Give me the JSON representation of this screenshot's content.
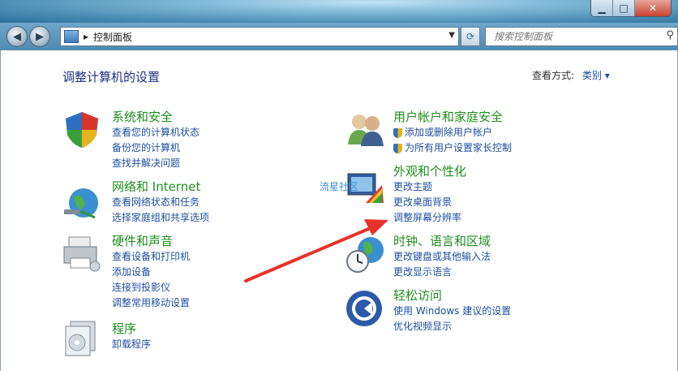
{
  "window": {
    "minimize_glyph": "▁",
    "maximize_glyph": "□",
    "close_glyph": "✕"
  },
  "nav": {
    "back_glyph": "◀",
    "forward_glyph": "▶",
    "address_crumb": "控制面板",
    "address_separator": "▸",
    "search_placeholder": "搜索控制面板"
  },
  "page": {
    "title": "调整计算机的设置",
    "view_by_label": "查看方式:",
    "view_by_value": "类别 ▾"
  },
  "categories": [
    {
      "title": "系统和安全",
      "links": [
        "查看您的计算机状态",
        "备份您的计算机",
        "查找并解决问题"
      ],
      "icon": "shield-icon"
    },
    {
      "title": "网络和 Internet",
      "links": [
        "查看网络状态和任务",
        "选择家庭组和共享选项"
      ],
      "icon": "network-globe-icon"
    },
    {
      "title": "硬件和声音",
      "links": [
        "查看设备和打印机",
        "添加设备",
        "连接到投影仪",
        "调整常用移动设置"
      ],
      "icon": "printer-icon"
    },
    {
      "title": "程序",
      "links": [
        "卸载程序"
      ],
      "icon": "programs-icon"
    },
    {
      "title": "用户帐户和家庭安全",
      "links": [
        "添加或删除用户帐户",
        "为所有用户设置家长控制"
      ],
      "icon": "users-icon"
    },
    {
      "title": "外观和个性化",
      "links": [
        "更改主题",
        "更改桌面背景",
        "调整屏幕分辨率"
      ],
      "icon": "appearance-icon"
    },
    {
      "title": "时钟、语言和区域",
      "links": [
        "更改键盘或其他输入法",
        "更改显示语言"
      ],
      "icon": "clock-globe-icon"
    },
    {
      "title": "轻松访问",
      "links": [
        "使用 Windows 建议的设置",
        "优化视频显示"
      ],
      "icon": "ease-of-access-icon"
    }
  ],
  "watermark": "流星社区",
  "colors": {
    "category_title": "#1e8f1e",
    "link": "#1e4fa3",
    "page_title": "#1e3287",
    "annotation_arrow": "#e8322a"
  }
}
